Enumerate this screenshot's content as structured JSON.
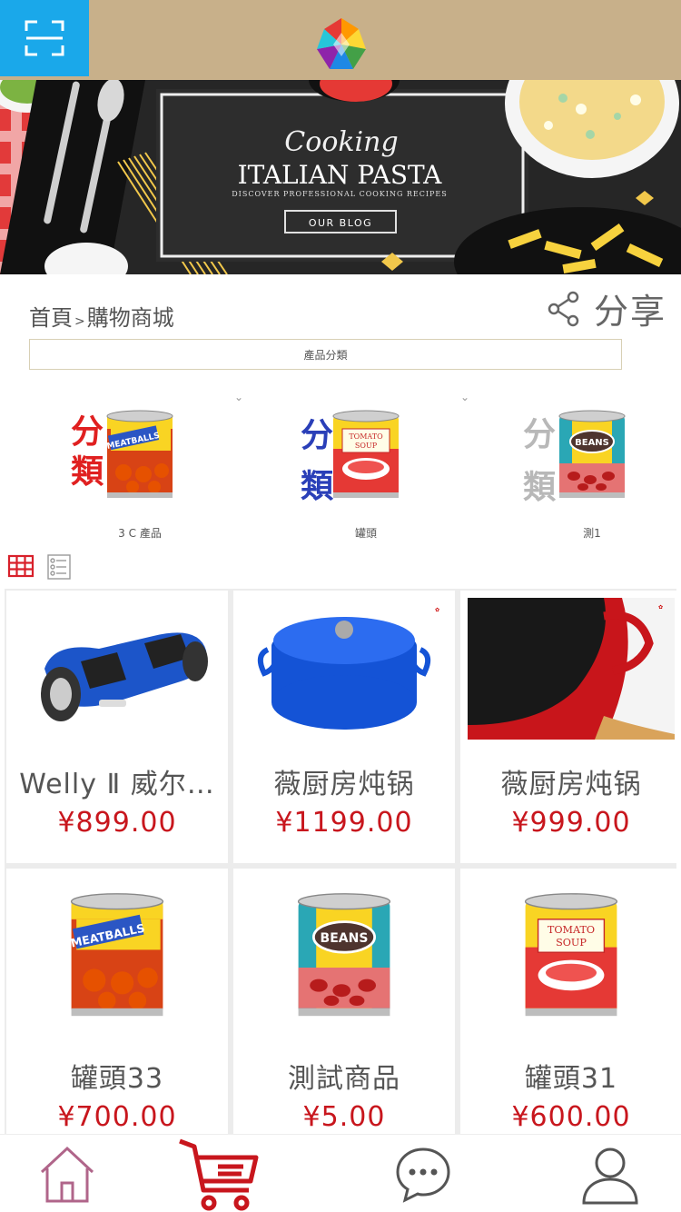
{
  "header": {
    "scan_icon": "scan-icon",
    "logo_icon": "colorful-gem-logo",
    "bg_color": "#c8b08a",
    "scan_bg": "#1aa8ea"
  },
  "banner": {
    "script_title": "Cooking",
    "title": "ITALIAN PASTA",
    "subtitle": "DISCOVER PROFESSIONAL COOKING RECIPES",
    "button": "OUR BLOG"
  },
  "breadcrumb": {
    "home": "首頁",
    "separator": ">",
    "current": "購物商城"
  },
  "share": {
    "label": "分享",
    "icon": "share-icon"
  },
  "category_bar": {
    "label": "產品分類"
  },
  "categories": [
    {
      "badge_top": "分",
      "badge_bottom": "類",
      "label": "3 C 產品",
      "can": "MEATBALLS",
      "badge_color": "#e02020"
    },
    {
      "badge_top": "分",
      "badge_bottom": "類",
      "label": "罐頭",
      "can": "TOMATO SOUP",
      "badge_color": "#2a3fb8"
    },
    {
      "badge_top": "分",
      "badge_bottom": "類",
      "label": "測1",
      "can": "BEANS",
      "badge_color": "#b8b8b8"
    }
  ],
  "view_toggle": {
    "grid_icon": "grid-view-icon",
    "list_icon": "list-view-icon"
  },
  "products": [
    {
      "name": "Welly Ⅱ 威尔…",
      "price": "¥899.00",
      "image": "hoverboard"
    },
    {
      "name": "薇厨房炖锅",
      "price": "¥1199.00",
      "image": "blue-pot"
    },
    {
      "name": "薇厨房炖锅",
      "price": "¥999.00",
      "image": "red-pot"
    },
    {
      "name": "罐頭33",
      "price": "¥700.00",
      "image": "meatballs-can"
    },
    {
      "name": "測試商品",
      "price": "¥5.00",
      "image": "beans-can"
    },
    {
      "name": "罐頭31",
      "price": "¥600.00",
      "image": "tomato-soup-can"
    }
  ],
  "nav": {
    "home_icon": "home-icon",
    "cart_icon": "cart-icon",
    "chat_icon": "chat-icon",
    "user_icon": "user-icon",
    "accent": "#c8161d"
  }
}
